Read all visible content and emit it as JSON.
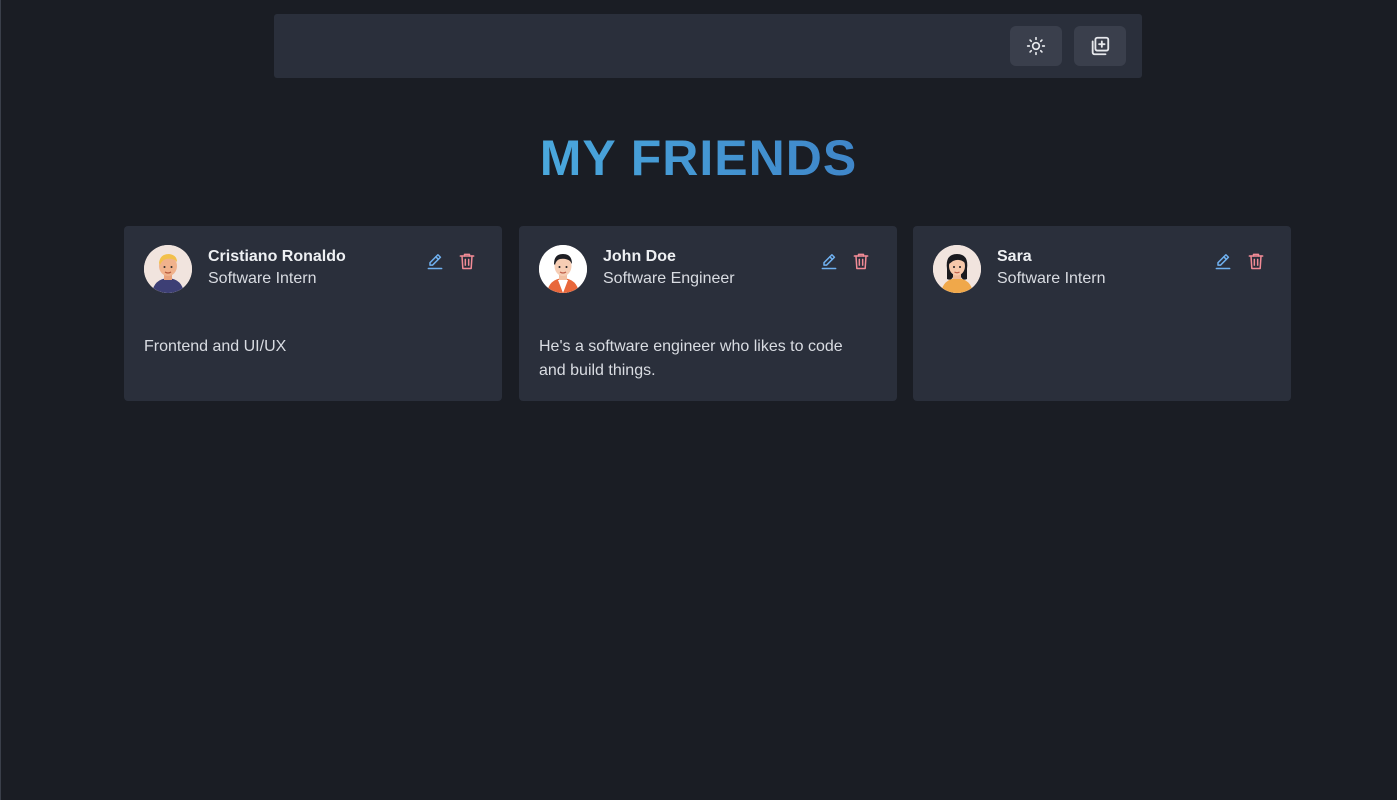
{
  "header": {
    "theme_toggle_icon": "sun-icon",
    "add_friend_icon": "add-square-icon"
  },
  "page": {
    "title": "MY FRIENDS",
    "title_gradient": [
      "#4aa8dd",
      "#3f86c9"
    ]
  },
  "colors": {
    "background": "#1a1d24",
    "card": "#2a2f3b",
    "edit_icon": "#6fb0ef",
    "delete_icon": "#f28b96"
  },
  "friends": [
    {
      "name": "Cristiano Ronaldo",
      "role": "Software Intern",
      "description": "Frontend and UI/UX",
      "avatar": "man-blond-avatar"
    },
    {
      "name": "John Doe",
      "role": "Software Engineer",
      "description": "He's a software engineer who likes to code and build things.",
      "avatar": "man-dark-hair-avatar"
    },
    {
      "name": "Sara",
      "role": "Software Intern",
      "description": "",
      "avatar": "woman-avatar"
    }
  ]
}
